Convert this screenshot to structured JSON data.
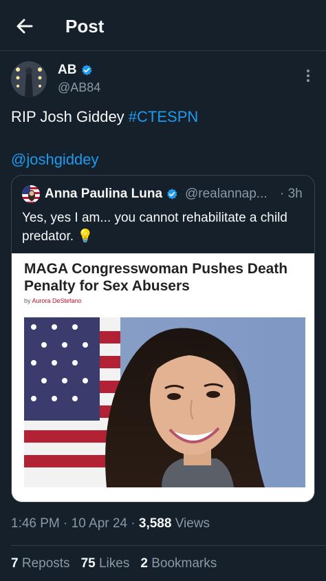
{
  "header": {
    "title": "Post"
  },
  "post": {
    "author_name": "AB",
    "author_handle": "@AB84",
    "text_prefix": "RIP Josh Giddey ",
    "hashtag": "#CTESPN",
    "mention": "@joshgiddey",
    "time": "1:46 PM",
    "date": "10 Apr 24",
    "views_count": "3,588",
    "views_label": "Views",
    "reposts_count": "7",
    "reposts_label": "Reposts",
    "likes_count": "75",
    "likes_label": "Likes",
    "bookmarks_count": "2",
    "bookmarks_label": "Bookmarks"
  },
  "quote": {
    "author_name": "Anna Paulina Luna",
    "author_handle": "@realannap...",
    "time": "3h",
    "text": "Yes, yes I am... you cannot rehabilitate a child predator.",
    "emoji": "💡",
    "article": {
      "headline": "MAGA Congresswoman Pushes Death Penalty for Sex Abusers",
      "byline_prefix": "by",
      "byline_author": "Aurora DeStefano"
    }
  },
  "colors": {
    "background": "#15202b",
    "accent": "#1d9bf0",
    "secondary_text": "#8b98a5"
  },
  "icons": [
    "back-arrow-icon",
    "verified-badge-icon",
    "more-options-icon",
    "lightbulb-emoji"
  ]
}
